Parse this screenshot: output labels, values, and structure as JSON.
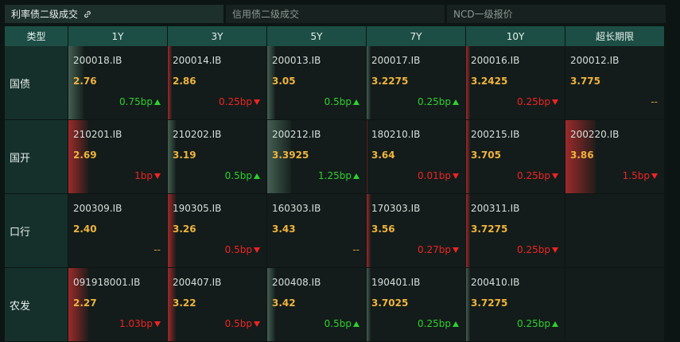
{
  "tabs": [
    "利率债二级成交",
    "信用债二级成交",
    "NCD一级报价"
  ],
  "header": {
    "type_label": "类型",
    "columns": [
      "1Y",
      "3Y",
      "5Y",
      "7Y",
      "10Y",
      "超长期限"
    ]
  },
  "rows": [
    {
      "label": "国债",
      "cells": [
        {
          "code": "200018.IB",
          "yield": "2.76",
          "change": "0.75bp",
          "dir": "up",
          "bar": 0.15
        },
        {
          "code": "200014.IB",
          "yield": "2.86",
          "change": "0.25bp",
          "dir": "down",
          "bar": 0.04
        },
        {
          "code": "200013.IB",
          "yield": "3.05",
          "change": "0.5bp",
          "dir": "up",
          "bar": 0.08
        },
        {
          "code": "200017.IB",
          "yield": "3.2275",
          "change": "0.25bp",
          "dir": "up",
          "bar": 0.04
        },
        {
          "code": "200016.IB",
          "yield": "3.2425",
          "change": "0.25bp",
          "dir": "down",
          "bar": 0.04
        },
        {
          "code": "200012.IB",
          "yield": "3.775",
          "change": "--",
          "dir": "none",
          "bar": 0
        }
      ]
    },
    {
      "label": "国开",
      "cells": [
        {
          "code": "210201.IB",
          "yield": "2.69",
          "change": "1bp",
          "dir": "down",
          "bar": 0.2
        },
        {
          "code": "210202.IB",
          "yield": "3.19",
          "change": "0.5bp",
          "dir": "up",
          "bar": 0.08
        },
        {
          "code": "200212.IB",
          "yield": "3.3925",
          "change": "1.25bp",
          "dir": "up",
          "bar": 0.24
        },
        {
          "code": "180210.IB",
          "yield": "3.64",
          "change": "0.01bp",
          "dir": "down",
          "bar": 0.01
        },
        {
          "code": "200215.IB",
          "yield": "3.705",
          "change": "0.25bp",
          "dir": "down",
          "bar": 0.04
        },
        {
          "code": "200220.IB",
          "yield": "3.86",
          "change": "1.5bp",
          "dir": "down",
          "bar": 0.3
        }
      ]
    },
    {
      "label": "口行",
      "cells": [
        {
          "code": "200309.IB",
          "yield": "2.40",
          "change": "--",
          "dir": "none",
          "bar": 0
        },
        {
          "code": "190305.IB",
          "yield": "3.26",
          "change": "0.5bp",
          "dir": "down",
          "bar": 0.08
        },
        {
          "code": "160303.IB",
          "yield": "3.43",
          "change": "--",
          "dir": "none",
          "bar": 0
        },
        {
          "code": "170303.IB",
          "yield": "3.56",
          "change": "0.27bp",
          "dir": "down",
          "bar": 0.04
        },
        {
          "code": "200311.IB",
          "yield": "3.7275",
          "change": "0.25bp",
          "dir": "down",
          "bar": 0.04
        },
        null
      ]
    },
    {
      "label": "农发",
      "cells": [
        {
          "code": "091918001.IB",
          "yield": "2.27",
          "change": "1.03bp",
          "dir": "down",
          "bar": 0.2
        },
        {
          "code": "200407.IB",
          "yield": "3.22",
          "change": "0.5bp",
          "dir": "down",
          "bar": 0.08
        },
        {
          "code": "200408.IB",
          "yield": "3.42",
          "change": "0.5bp",
          "dir": "up",
          "bar": 0.08
        },
        {
          "code": "190401.IB",
          "yield": "3.7025",
          "change": "0.25bp",
          "dir": "up",
          "bar": 0.04
        },
        {
          "code": "200410.IB",
          "yield": "3.7275",
          "change": "0.25bp",
          "dir": "up",
          "bar": 0.04
        },
        null
      ]
    }
  ],
  "colors": {
    "up": "#2ed12e",
    "down": "#ef2424",
    "yield": "#f0b43c",
    "header_bg": "#1c4e45"
  }
}
